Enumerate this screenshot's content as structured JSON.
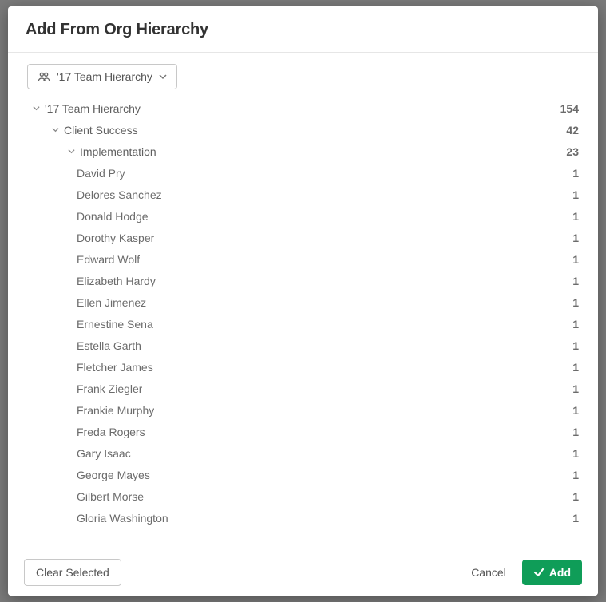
{
  "modal": {
    "title": "Add From Org Hierarchy"
  },
  "dropdown": {
    "label": "'17 Team Hierarchy"
  },
  "tree": {
    "root": {
      "label": "'17 Team Hierarchy",
      "count": 154
    },
    "level1": {
      "label": "Client Success",
      "count": 42
    },
    "level2": {
      "label": "Implementation",
      "count": 23
    },
    "people": [
      {
        "name": "David Pry",
        "count": 1
      },
      {
        "name": "Delores Sanchez",
        "count": 1
      },
      {
        "name": "Donald Hodge",
        "count": 1
      },
      {
        "name": "Dorothy Kasper",
        "count": 1
      },
      {
        "name": "Edward Wolf",
        "count": 1
      },
      {
        "name": "Elizabeth Hardy",
        "count": 1
      },
      {
        "name": "Ellen Jimenez",
        "count": 1
      },
      {
        "name": "Ernestine Sena",
        "count": 1
      },
      {
        "name": "Estella Garth",
        "count": 1
      },
      {
        "name": "Fletcher James",
        "count": 1
      },
      {
        "name": "Frank Ziegler",
        "count": 1
      },
      {
        "name": "Frankie Murphy",
        "count": 1
      },
      {
        "name": "Freda Rogers",
        "count": 1
      },
      {
        "name": "Gary Isaac",
        "count": 1
      },
      {
        "name": "George Mayes",
        "count": 1
      },
      {
        "name": "Gilbert Morse",
        "count": 1
      },
      {
        "name": "Gloria Washington",
        "count": 1
      }
    ]
  },
  "footer": {
    "clear": "Clear Selected",
    "cancel": "Cancel",
    "add": "Add"
  }
}
